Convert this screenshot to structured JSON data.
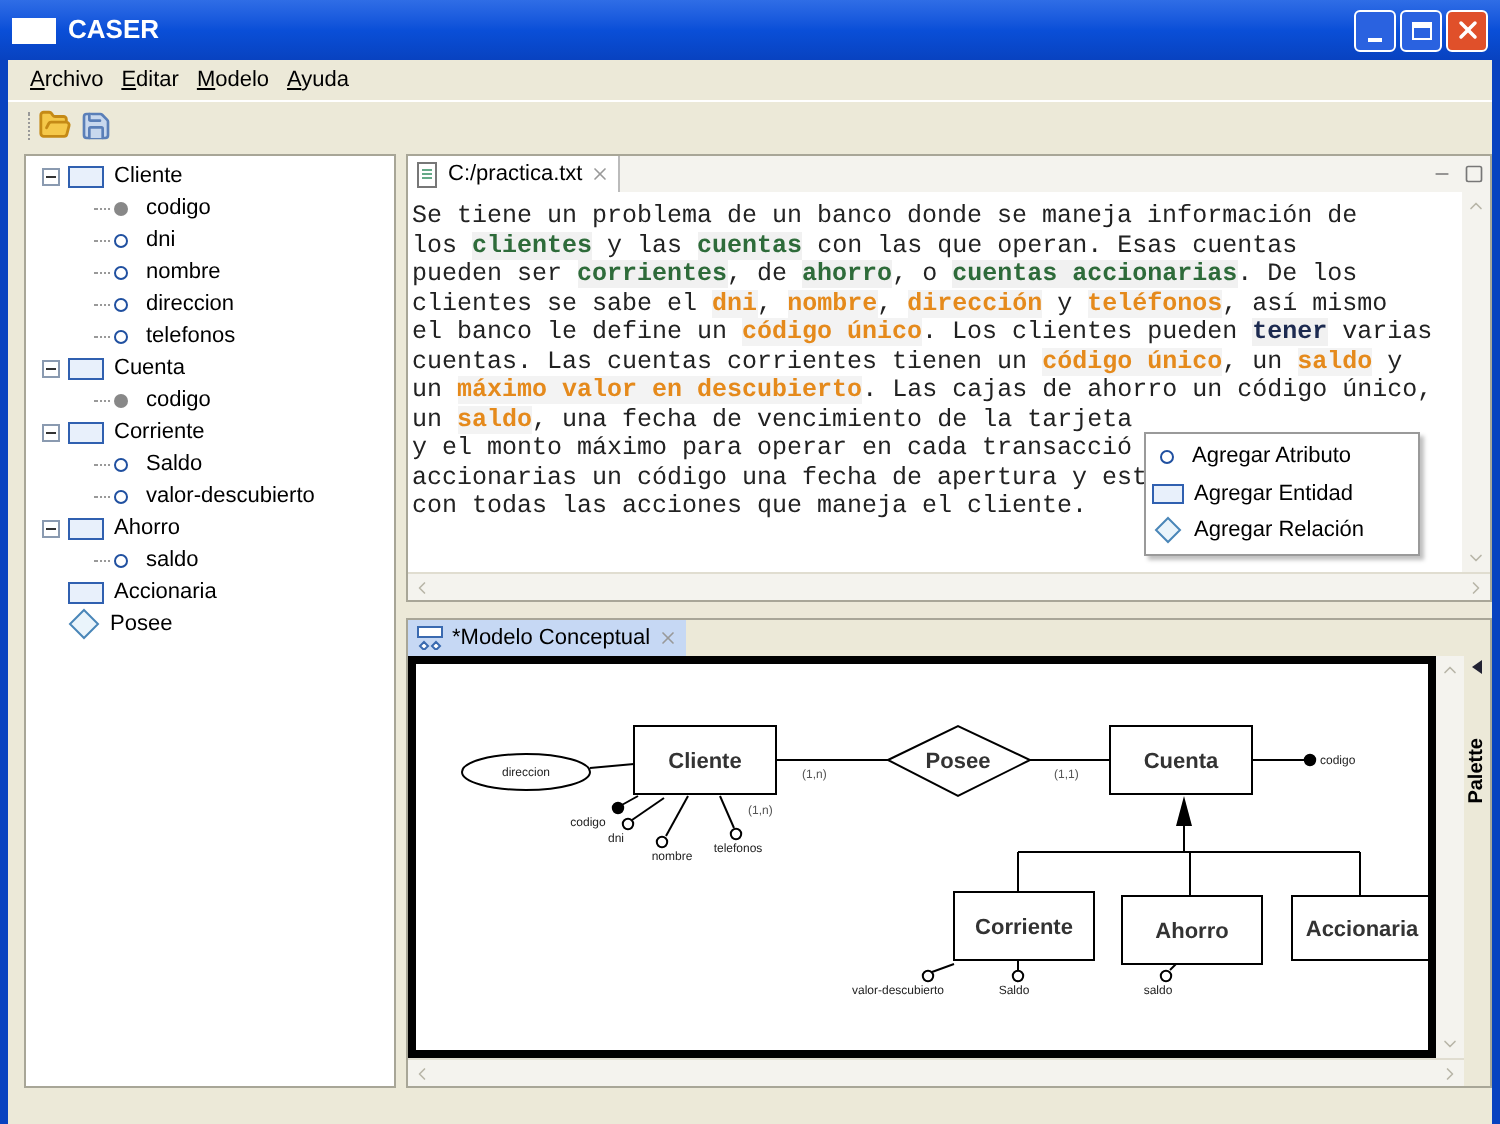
{
  "window": {
    "title": "CASER"
  },
  "menu": [
    {
      "label": "Archivo"
    },
    {
      "label": "Editar"
    },
    {
      "label": "Modelo"
    },
    {
      "label": "Ayuda"
    }
  ],
  "toolbar": [
    {
      "kind": "open"
    },
    {
      "kind": "save"
    }
  ],
  "tree": [
    {
      "label": "Cliente",
      "kind": "entity",
      "expanded": true,
      "children": [
        {
          "label": "codigo",
          "kind": "key"
        },
        {
          "label": "dni",
          "kind": "attribute"
        },
        {
          "label": "nombre",
          "kind": "attribute"
        },
        {
          "label": "direccion",
          "kind": "attribute"
        },
        {
          "label": "telefonos",
          "kind": "attribute"
        }
      ]
    },
    {
      "label": "Cuenta",
      "kind": "entity",
      "expanded": true,
      "children": [
        {
          "label": "codigo",
          "kind": "key"
        }
      ]
    },
    {
      "label": "Corriente",
      "kind": "entity",
      "expanded": true,
      "children": [
        {
          "label": "Saldo",
          "kind": "attribute"
        },
        {
          "label": "valor-descubierto",
          "kind": "attribute"
        }
      ]
    },
    {
      "label": "Ahorro",
      "kind": "entity",
      "expanded": true,
      "children": [
        {
          "label": "saldo",
          "kind": "attribute"
        }
      ]
    },
    {
      "label": "Accionaria",
      "kind": "entity"
    },
    {
      "label": "Posee",
      "kind": "relation"
    }
  ],
  "editor": {
    "tab": "C:/practica.txt",
    "lines": [
      [
        {
          "text": "Se tiene un problema de un banco donde se maneja información de",
          "kind": "plain"
        }
      ],
      [
        {
          "text": "los ",
          "kind": "plain"
        },
        {
          "text": "clientes",
          "kind": "entity"
        },
        {
          "text": " y las ",
          "kind": "plain"
        },
        {
          "text": "cuentas",
          "kind": "entity"
        },
        {
          "text": " con las que operan. Esas cuentas",
          "kind": "plain"
        }
      ],
      [
        {
          "text": "pueden ser ",
          "kind": "plain"
        },
        {
          "text": "corrientes",
          "kind": "entity"
        },
        {
          "text": ", de ",
          "kind": "plain"
        },
        {
          "text": "ahorro",
          "kind": "entity"
        },
        {
          "text": ", o ",
          "kind": "plain"
        },
        {
          "text": "cuentas accionarias",
          "kind": "entity"
        },
        {
          "text": ". De los",
          "kind": "plain"
        }
      ],
      [
        {
          "text": "clientes se sabe el ",
          "kind": "plain"
        },
        {
          "text": "dni",
          "kind": "attribute"
        },
        {
          "text": ", ",
          "kind": "plain"
        },
        {
          "text": "nombre",
          "kind": "attribute"
        },
        {
          "text": ", ",
          "kind": "plain"
        },
        {
          "text": "dirección",
          "kind": "attribute"
        },
        {
          "text": " y ",
          "kind": "plain"
        },
        {
          "text": "teléfonos",
          "kind": "attribute"
        },
        {
          "text": ", así mismo",
          "kind": "plain"
        }
      ],
      [
        {
          "text": "el banco le define un ",
          "kind": "plain"
        },
        {
          "text": "código único",
          "kind": "attribute"
        },
        {
          "text": ". Los clientes pueden ",
          "kind": "plain"
        },
        {
          "text": "tener",
          "kind": "relation"
        },
        {
          "text": " varias",
          "kind": "plain"
        }
      ],
      [
        {
          "text": "cuentas. Las cuentas corrientes tienen un ",
          "kind": "plain"
        },
        {
          "text": "código único",
          "kind": "attribute"
        },
        {
          "text": ", un ",
          "kind": "plain"
        },
        {
          "text": "saldo",
          "kind": "attribute"
        },
        {
          "text": " y",
          "kind": "plain"
        }
      ],
      [
        {
          "text": "un ",
          "kind": "plain"
        },
        {
          "text": "máximo valor en descubierto",
          "kind": "attribute"
        },
        {
          "text": ". Las cajas de ahorro un código único,",
          "kind": "plain"
        }
      ],
      [
        {
          "text": "un ",
          "kind": "plain"
        },
        {
          "text": "saldo",
          "kind": "attribute"
        },
        {
          "text": ", una fecha de vencimiento de la tarjeta",
          "kind": "plain"
        }
      ],
      [
        {
          "text": "y el monto máximo para operar en cada transacció",
          "kind": "plain"
        }
      ],
      [
        {
          "text": "accionarias un código una fecha de apertura y est",
          "kind": "plain"
        }
      ],
      [
        {
          "text": "con todas las acciones que maneja el cliente.",
          "kind": "plain"
        }
      ]
    ]
  },
  "context_menu": [
    {
      "label": "Agregar Atributo",
      "kind": "attribute"
    },
    {
      "label": "Agregar Entidad",
      "kind": "entity"
    },
    {
      "label": "Agregar Relación",
      "kind": "relation"
    }
  ],
  "diagram": {
    "tab": "*Modelo Conceptual",
    "palette": "Palette",
    "relation": "Posee",
    "entities": [
      {
        "name": "Cliente",
        "attributes": [
          {
            "label": "direccion",
            "kind": "ellipse"
          },
          {
            "label": "codigo",
            "kind": "key"
          },
          {
            "label": "dni",
            "kind": "simple"
          },
          {
            "label": "nombre",
            "kind": "simple"
          },
          {
            "label": "telefonos",
            "kind": "simple",
            "cardinality": "(1,n)"
          }
        ]
      },
      {
        "name": "Cuenta",
        "attributes": [
          {
            "label": "codigo",
            "kind": "key"
          }
        ]
      },
      {
        "name": "Corriente",
        "attributes": [
          {
            "label": "valor-descubierto",
            "kind": "simple"
          },
          {
            "label": "Saldo",
            "kind": "simple"
          }
        ]
      },
      {
        "name": "Ahorro",
        "attributes": [
          {
            "label": "saldo",
            "kind": "simple"
          }
        ]
      },
      {
        "name": "Accionaria"
      }
    ],
    "cardinalities": [
      "(1,n)",
      "(1,1)"
    ]
  }
}
